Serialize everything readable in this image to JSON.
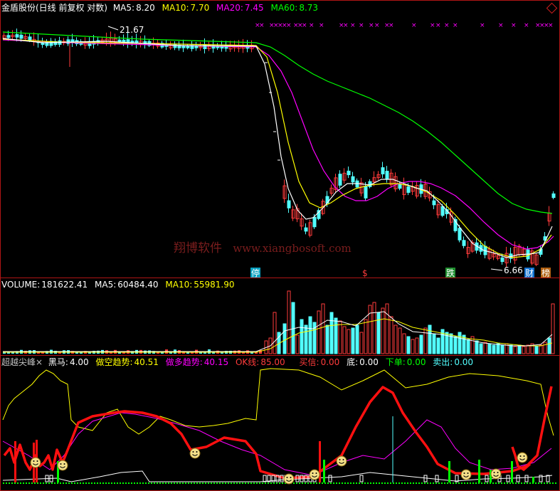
{
  "colors": {
    "bg": "#000000",
    "border": "#b01515",
    "white": "#ffffff",
    "yellow": "#ffff00",
    "magenta": "#ff00ff",
    "green": "#00ff00",
    "up": "#ff3b3b",
    "down": "#52ffff",
    "red_line": "#ff1010",
    "gray_label": "#c0c0c0"
  },
  "watermark": {
    "cn": "翔博软件",
    "url": "www.xiangbosoft.com"
  },
  "price_panel": {
    "title": "金盾股份(日线 前复权 对数)",
    "ma5": {
      "label": "MA5:",
      "value": "8.20"
    },
    "ma10": {
      "label": "MA10:",
      "value": "7.70"
    },
    "ma20": {
      "label": "MA20:",
      "value": "7.45"
    },
    "ma60": {
      "label": "MA60:",
      "value": "8.73"
    },
    "high_label": "21.67",
    "low_label": "6.66",
    "x_marker": "×",
    "flags": [
      "停",
      "$",
      "跌",
      "财",
      "榜"
    ]
  },
  "volume_panel": {
    "volume": {
      "label": "VOLUME:",
      "value": "181622.41"
    },
    "ma5": {
      "label": "MA5:",
      "value": "60484.40"
    },
    "ma10": {
      "label": "MA10:",
      "value": "55981.90"
    }
  },
  "indicator_panel": {
    "name": "超越尖峰",
    "close_mark": "×",
    "heima": {
      "label": "黑马:",
      "value": "4.00"
    },
    "zuokong": {
      "label": "做空趋势:",
      "value": "40.51"
    },
    "zuoduo": {
      "label": "做多趋势:",
      "value": "40.15"
    },
    "ok": {
      "label": "OK线:",
      "value": "85.00"
    },
    "maixin": {
      "label": "买信:",
      "value": "0.00"
    },
    "di": {
      "label": "底:",
      "value": "0.00"
    },
    "xiadan": {
      "label": "下单:",
      "value": "0.00"
    },
    "maichu": {
      "label": "卖出:",
      "value": "0.00"
    }
  },
  "chart_data": [
    {
      "type": "candlestick",
      "title": "金盾股份(日线 前复权 对数)",
      "annotations": [
        {
          "text": "21.67",
          "value": 21.67
        },
        {
          "text": "6.66",
          "value": 6.66
        }
      ],
      "ma_series": [
        {
          "name": "MA5",
          "last": 8.2,
          "color": "#ffffff"
        },
        {
          "name": "MA10",
          "last": 7.7,
          "color": "#ffff00"
        },
        {
          "name": "MA20",
          "last": 7.45,
          "color": "#ff00ff"
        },
        {
          "name": "MA60",
          "last": 8.73,
          "color": "#00ff00"
        }
      ]
    },
    {
      "type": "bar",
      "title": "VOLUME",
      "series": [
        {
          "name": "VOLUME",
          "last": 181622.41
        },
        {
          "name": "MA5",
          "last": 60484.4
        },
        {
          "name": "MA10",
          "last": 55981.9
        }
      ]
    },
    {
      "type": "line",
      "title": "超越尖峰",
      "series": [
        {
          "name": "黑马",
          "last": 4.0
        },
        {
          "name": "做空趋势",
          "last": 40.51
        },
        {
          "name": "做多趋势",
          "last": 40.15
        },
        {
          "name": "OK线",
          "last": 85.0
        },
        {
          "name": "买信",
          "last": 0.0
        },
        {
          "name": "底",
          "last": 0.0
        },
        {
          "name": "下单",
          "last": 0.0
        },
        {
          "name": "卖出",
          "last": 0.0
        }
      ]
    }
  ]
}
